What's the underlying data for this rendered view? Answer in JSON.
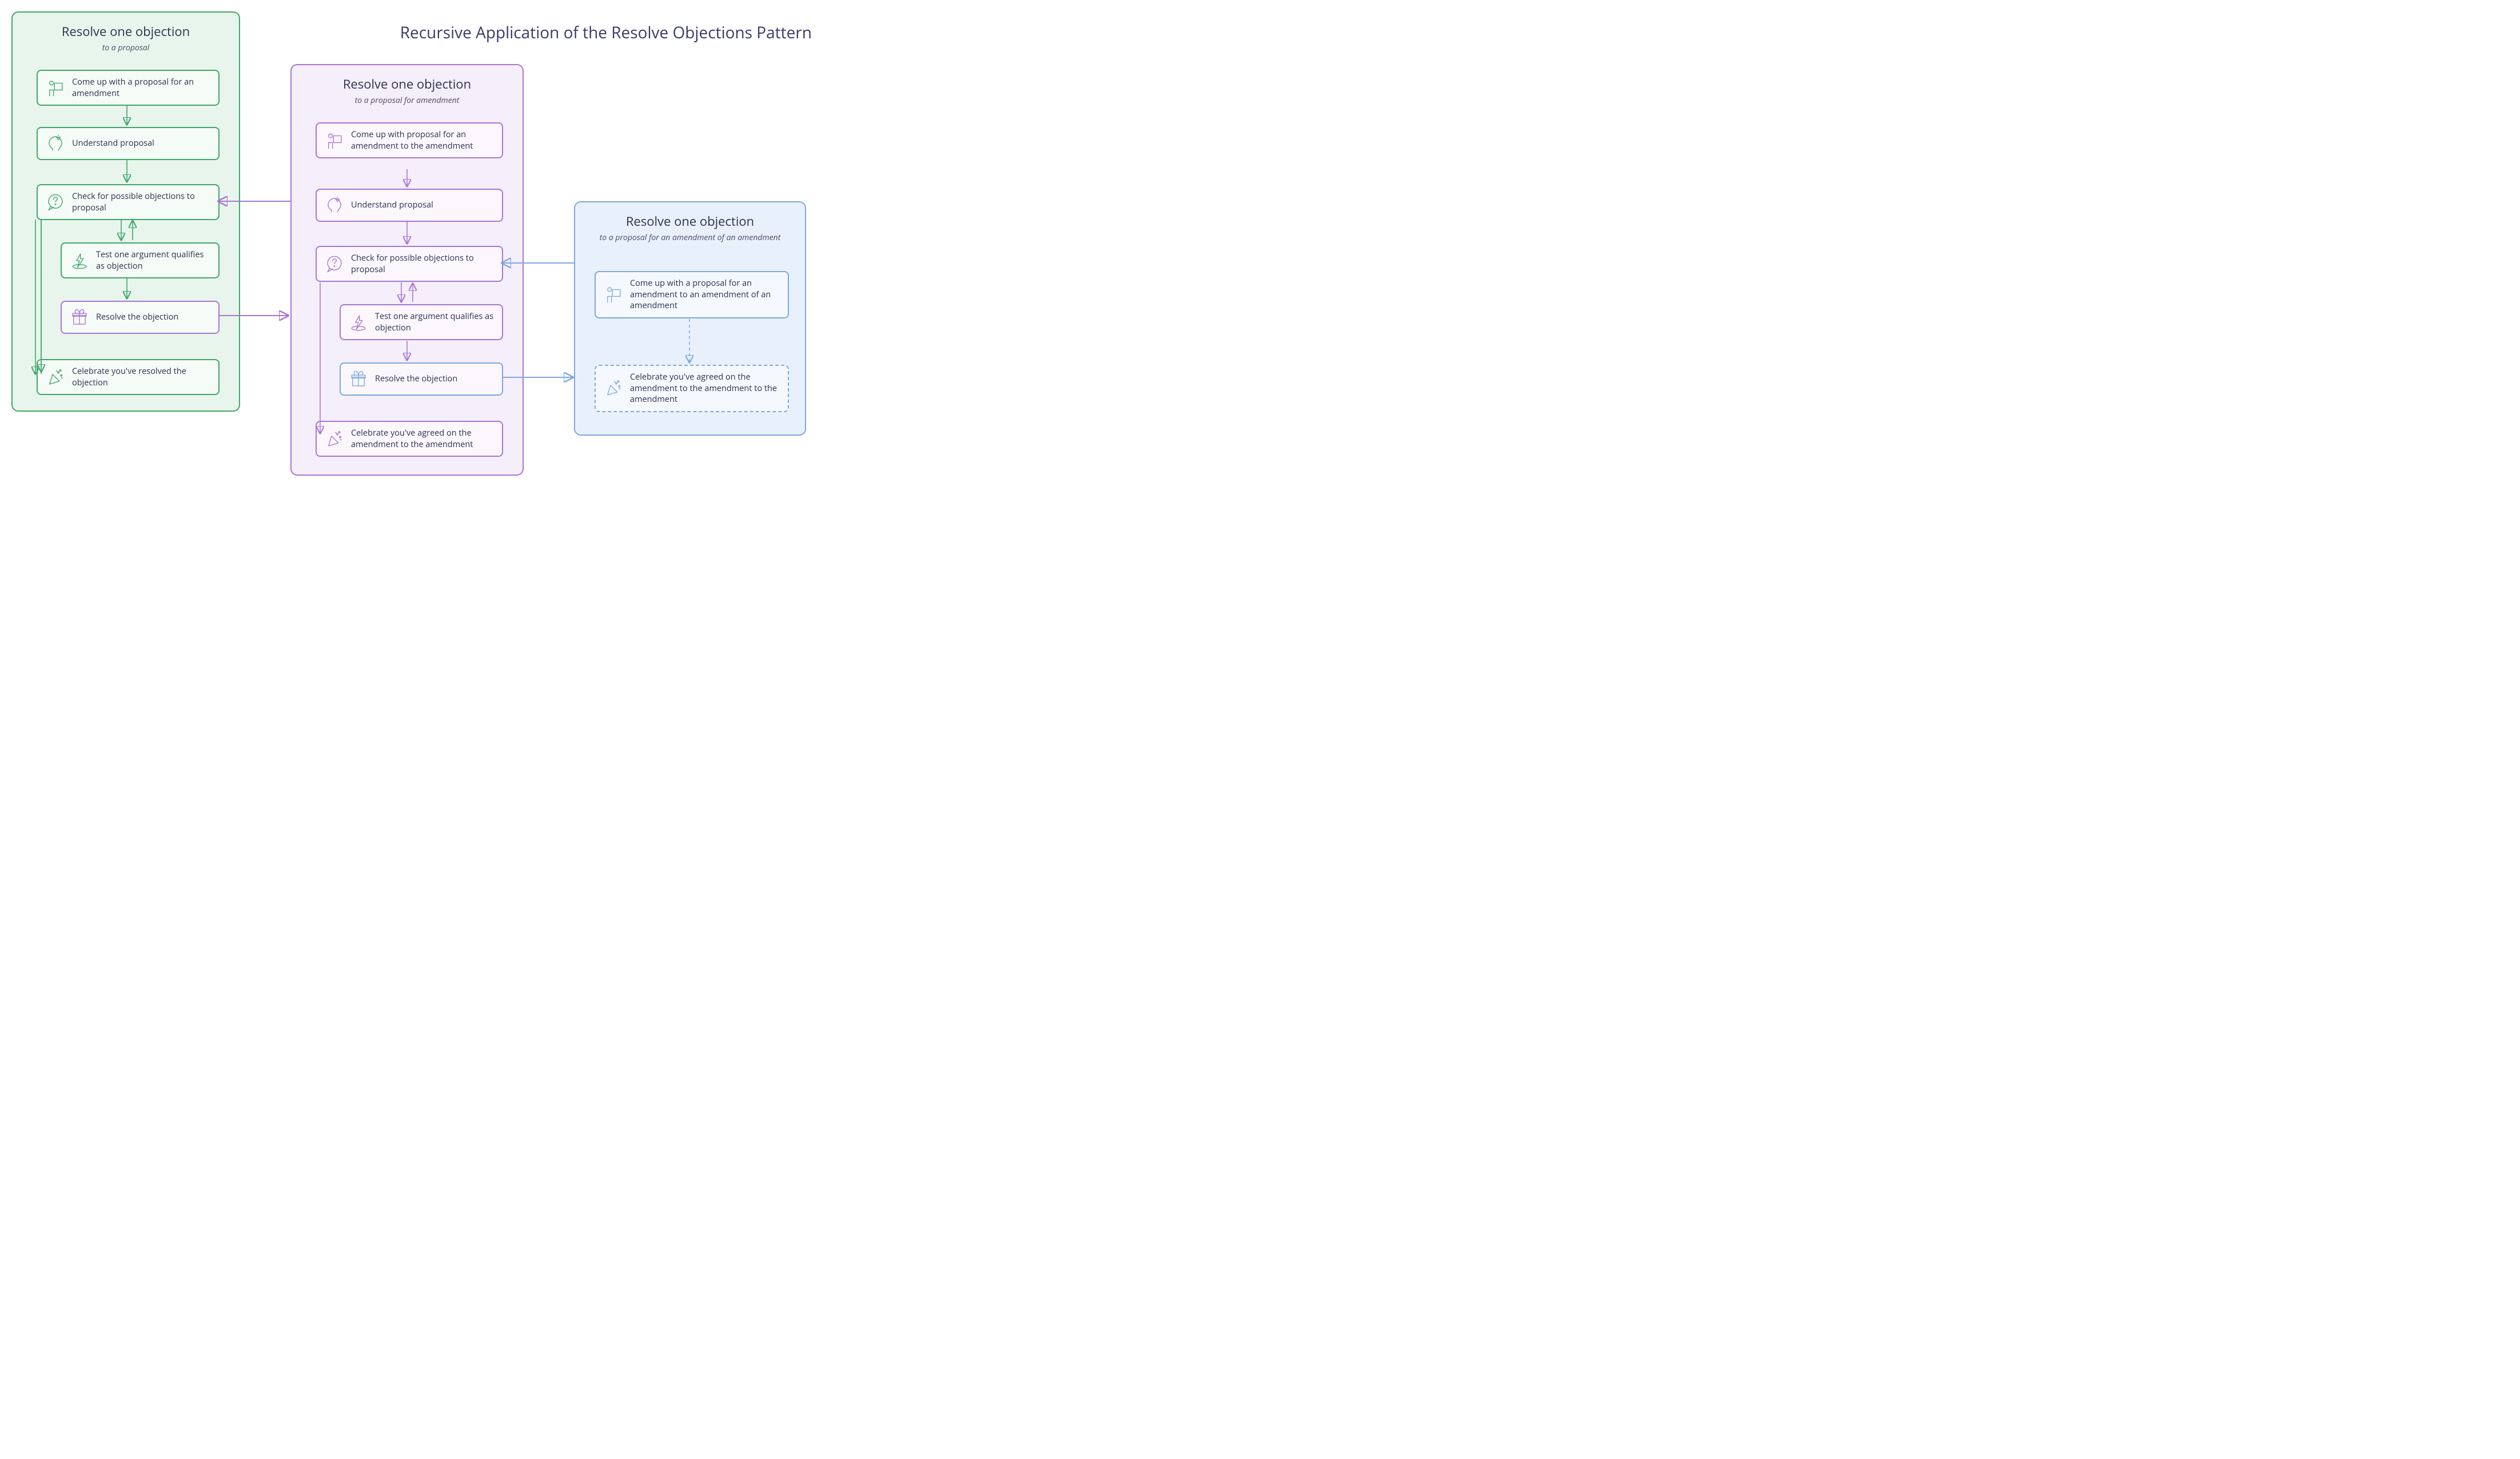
{
  "title": "Recursive Application of the  Resolve Objections Pattern",
  "colors": {
    "green": "#3fa66a",
    "purple": "#a876d6",
    "blue": "#7ea8e0",
    "text": "#2d3250"
  },
  "panels": {
    "green": {
      "title": "Resolve one objection",
      "subtitle": "to a proposal",
      "steps": {
        "s1": "Come up with a proposal for an amendment",
        "s2": "Understand proposal",
        "s3": "Check for possible objections to proposal",
        "s4": "Test one argument qualifies as objection",
        "s5": "Resolve the objection",
        "s6": "Celebrate you've resolved the objection"
      }
    },
    "purple": {
      "title": "Resolve one objection",
      "subtitle": "to a proposal for amendment",
      "steps": {
        "s1": "Come up with proposal for an amendment to the amendment",
        "s2": "Understand proposal",
        "s3": "Check for possible objections to proposal",
        "s4": "Test one argument qualifies as objection",
        "s5": "Resolve the objection",
        "s6": "Celebrate you've agreed on the amendment to the amendment"
      }
    },
    "blue": {
      "title": "Resolve one objection",
      "subtitle": "to a proposal for an amendment of an amendment",
      "steps": {
        "s1": "Come up with a proposal for an amendment to an amendment of an amendment",
        "s6": "Celebrate you've agreed on the amendment to the amendment to the amendment"
      }
    }
  }
}
